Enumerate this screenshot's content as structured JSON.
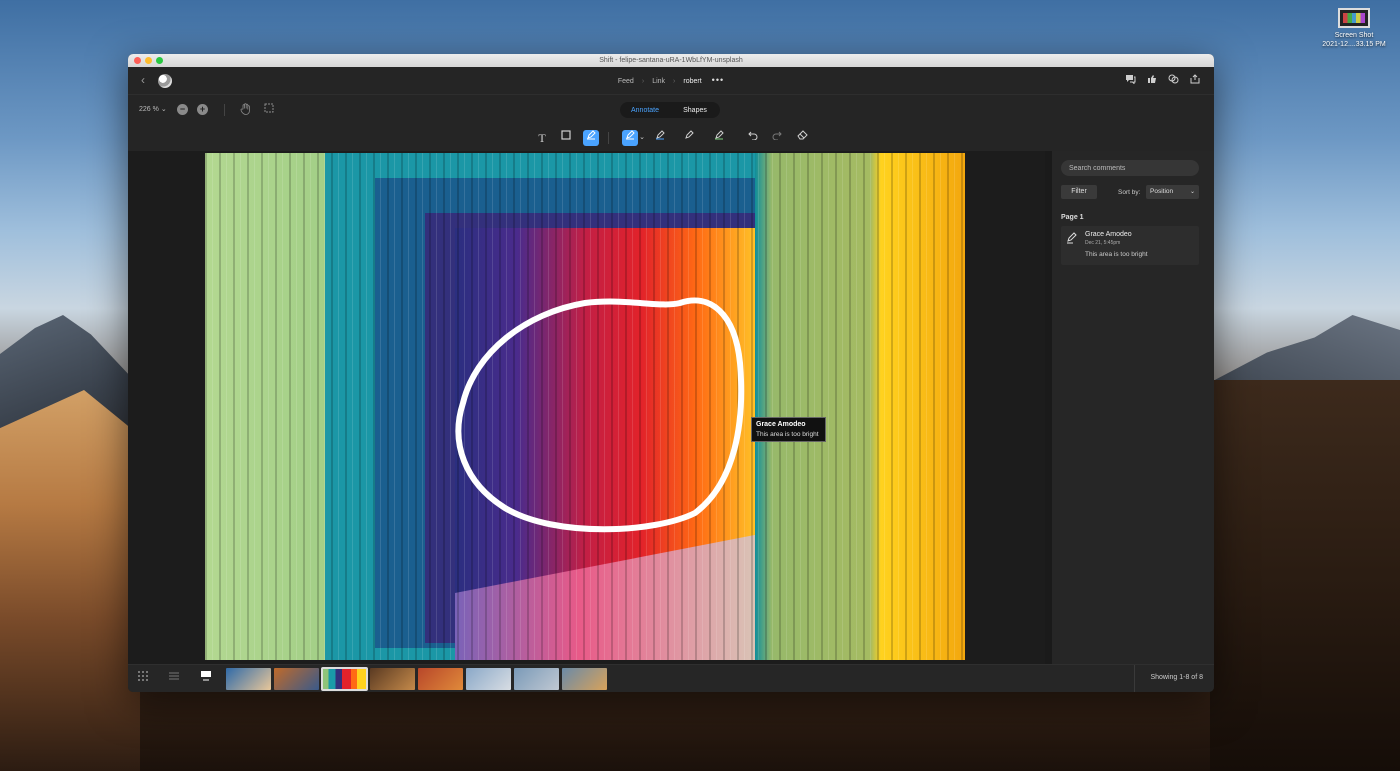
{
  "desktop": {
    "icon_label": "Screen Shot\n2021-12....33.15 PM"
  },
  "window": {
    "title": "Shift - felipe-santana-uRA-1WbLfYM-unsplash"
  },
  "topbar": {
    "breadcrumb": [
      "Feed",
      "Link",
      "robert"
    ],
    "more_label": "•••"
  },
  "toolbar": {
    "zoom_label": "226 %",
    "segments": {
      "annotate": "Annotate",
      "shapes": "Shapes"
    },
    "active_segment": "Annotate"
  },
  "canvas": {
    "tooltip": {
      "name": "Grace Amodeo",
      "text": "This area is too bright"
    }
  },
  "sidepanel": {
    "search_placeholder": "Search comments",
    "filter_label": "Filter",
    "sort_label": "Sort by:",
    "sort_value": "Position",
    "page_header": "Page 1",
    "comments": [
      {
        "author": "Grace Amodeo",
        "date": "Dec 21, 5:45pm",
        "text": "This area is too bright"
      }
    ]
  },
  "bottombar": {
    "showing": "Showing 1-8 of 8",
    "thumbnails": [
      {
        "colors": [
          "#2f6aa8",
          "#e8c79a"
        ]
      },
      {
        "colors": [
          "#c06a2a",
          "#3a5a8a"
        ]
      },
      {
        "colors": [
          "#e83a3a",
          "#f2c12e"
        ],
        "selected": true
      },
      {
        "colors": [
          "#5a3a22",
          "#c58a4a"
        ]
      },
      {
        "colors": [
          "#b8472a",
          "#e08a3a"
        ]
      },
      {
        "colors": [
          "#8aa8c8",
          "#d8dde3"
        ]
      },
      {
        "colors": [
          "#7a9ab8",
          "#c0c8d2"
        ]
      },
      {
        "colors": [
          "#6a8aa8",
          "#d8a25a"
        ]
      }
    ]
  },
  "colors": {
    "accent": "#4aa3ff",
    "annotation_stroke": "#ffffff"
  }
}
